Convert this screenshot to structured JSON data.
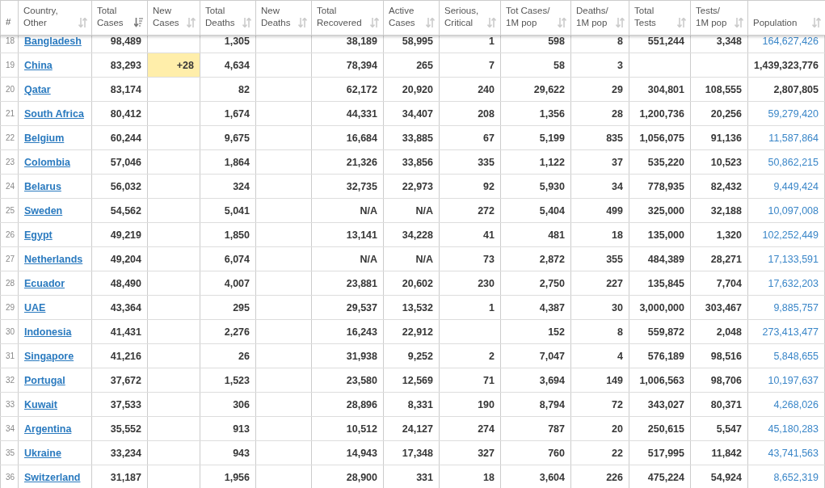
{
  "columns": [
    {
      "label": "#",
      "sortable": false
    },
    {
      "label": "Country,\nOther",
      "sortable": true,
      "sorted": false
    },
    {
      "label": "Total\nCases",
      "sortable": true,
      "sorted": true
    },
    {
      "label": "New\nCases",
      "sortable": true,
      "sorted": false
    },
    {
      "label": "Total\nDeaths",
      "sortable": true,
      "sorted": false
    },
    {
      "label": "New\nDeaths",
      "sortable": true,
      "sorted": false
    },
    {
      "label": "Total\nRecovered",
      "sortable": true,
      "sorted": false
    },
    {
      "label": "Active\nCases",
      "sortable": true,
      "sorted": false
    },
    {
      "label": "Serious,\nCritical",
      "sortable": true,
      "sorted": false
    },
    {
      "label": "Tot Cases/\n1M pop",
      "sortable": true,
      "sorted": false
    },
    {
      "label": "Deaths/\n1M pop",
      "sortable": true,
      "sorted": false
    },
    {
      "label": "Total\nTests",
      "sortable": true,
      "sorted": false
    },
    {
      "label": "Tests/\n1M pop",
      "sortable": true,
      "sorted": false
    },
    {
      "label": "Population",
      "sortable": true,
      "sorted": false
    }
  ],
  "rows": [
    {
      "cells": [
        "18",
        "Bangladesh",
        "98,489",
        null,
        "1,305",
        null,
        "38,189",
        "58,995",
        "1",
        "598",
        "8",
        "551,244",
        "3,348",
        "164,627,426"
      ],
      "population_link": true
    },
    {
      "cells": [
        "19",
        "China",
        "83,293",
        "+28",
        "4,634",
        null,
        "78,394",
        "265",
        "7",
        "58",
        "3",
        null,
        null,
        "1,439,323,776"
      ],
      "population_link": false
    },
    {
      "cells": [
        "20",
        "Qatar",
        "83,174",
        null,
        "82",
        null,
        "62,172",
        "20,920",
        "240",
        "29,622",
        "29",
        "304,801",
        "108,555",
        "2,807,805"
      ],
      "population_link": false
    },
    {
      "cells": [
        "21",
        "South Africa",
        "80,412",
        null,
        "1,674",
        null,
        "44,331",
        "34,407",
        "208",
        "1,356",
        "28",
        "1,200,736",
        "20,256",
        "59,279,420"
      ],
      "population_link": true
    },
    {
      "cells": [
        "22",
        "Belgium",
        "60,244",
        null,
        "9,675",
        null,
        "16,684",
        "33,885",
        "67",
        "5,199",
        "835",
        "1,056,075",
        "91,136",
        "11,587,864"
      ],
      "population_link": true
    },
    {
      "cells": [
        "23",
        "Colombia",
        "57,046",
        null,
        "1,864",
        null,
        "21,326",
        "33,856",
        "335",
        "1,122",
        "37",
        "535,220",
        "10,523",
        "50,862,215"
      ],
      "population_link": true
    },
    {
      "cells": [
        "24",
        "Belarus",
        "56,032",
        null,
        "324",
        null,
        "32,735",
        "22,973",
        "92",
        "5,930",
        "34",
        "778,935",
        "82,432",
        "9,449,424"
      ],
      "population_link": true
    },
    {
      "cells": [
        "25",
        "Sweden",
        "54,562",
        null,
        "5,041",
        null,
        "N/A",
        "N/A",
        "272",
        "5,404",
        "499",
        "325,000",
        "32,188",
        "10,097,008"
      ],
      "population_link": true
    },
    {
      "cells": [
        "26",
        "Egypt",
        "49,219",
        null,
        "1,850",
        null,
        "13,141",
        "34,228",
        "41",
        "481",
        "18",
        "135,000",
        "1,320",
        "102,252,449"
      ],
      "population_link": true
    },
    {
      "cells": [
        "27",
        "Netherlands",
        "49,204",
        null,
        "6,074",
        null,
        "N/A",
        "N/A",
        "73",
        "2,872",
        "355",
        "484,389",
        "28,271",
        "17,133,591"
      ],
      "population_link": true
    },
    {
      "cells": [
        "28",
        "Ecuador",
        "48,490",
        null,
        "4,007",
        null,
        "23,881",
        "20,602",
        "230",
        "2,750",
        "227",
        "135,845",
        "7,704",
        "17,632,203"
      ],
      "population_link": true
    },
    {
      "cells": [
        "29",
        "UAE",
        "43,364",
        null,
        "295",
        null,
        "29,537",
        "13,532",
        "1",
        "4,387",
        "30",
        "3,000,000",
        "303,467",
        "9,885,757"
      ],
      "population_link": true
    },
    {
      "cells": [
        "30",
        "Indonesia",
        "41,431",
        null,
        "2,276",
        null,
        "16,243",
        "22,912",
        null,
        "152",
        "8",
        "559,872",
        "2,048",
        "273,413,477"
      ],
      "population_link": true
    },
    {
      "cells": [
        "31",
        "Singapore",
        "41,216",
        null,
        "26",
        null,
        "31,938",
        "9,252",
        "2",
        "7,047",
        "4",
        "576,189",
        "98,516",
        "5,848,655"
      ],
      "population_link": true
    },
    {
      "cells": [
        "32",
        "Portugal",
        "37,672",
        null,
        "1,523",
        null,
        "23,580",
        "12,569",
        "71",
        "3,694",
        "149",
        "1,006,563",
        "98,706",
        "10,197,637"
      ],
      "population_link": true
    },
    {
      "cells": [
        "33",
        "Kuwait",
        "37,533",
        null,
        "306",
        null,
        "28,896",
        "8,331",
        "190",
        "8,794",
        "72",
        "343,027",
        "80,371",
        "4,268,026"
      ],
      "population_link": true
    },
    {
      "cells": [
        "34",
        "Argentina",
        "35,552",
        null,
        "913",
        null,
        "10,512",
        "24,127",
        "274",
        "787",
        "20",
        "250,615",
        "5,547",
        "45,180,283"
      ],
      "population_link": true
    },
    {
      "cells": [
        "35",
        "Ukraine",
        "33,234",
        null,
        "943",
        null,
        "14,943",
        "17,348",
        "327",
        "760",
        "22",
        "517,995",
        "11,842",
        "43,741,563"
      ],
      "population_link": true
    },
    {
      "cells": [
        "36",
        "Switzerland",
        "31,187",
        null,
        "1,956",
        null,
        "28,900",
        "331",
        "18",
        "3,604",
        "226",
        "475,224",
        "54,924",
        "8,652,319"
      ],
      "population_link": true
    }
  ]
}
